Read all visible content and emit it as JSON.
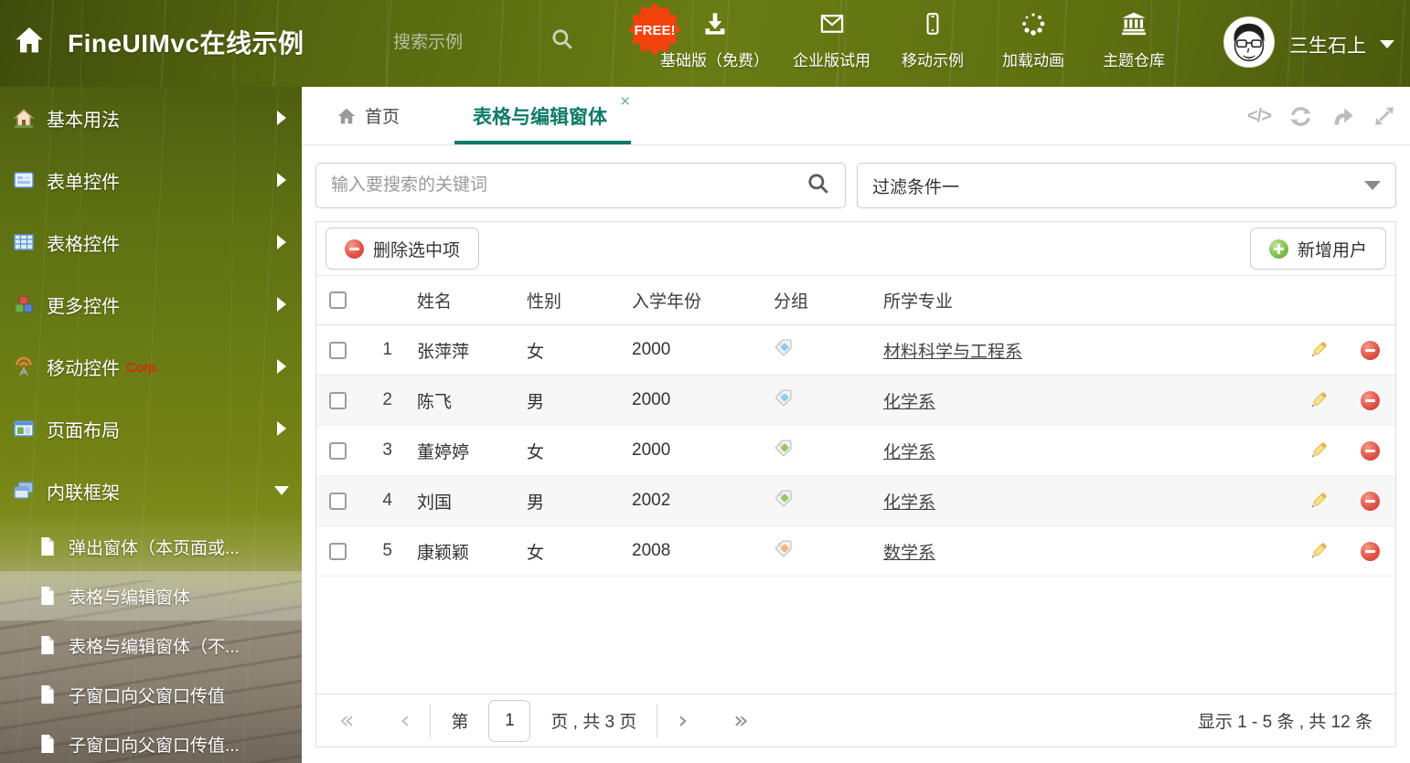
{
  "header": {
    "title": "FineUIMvc在线示例",
    "search_placeholder": "搜索示例",
    "free_badge": "FREE!",
    "nav_items": [
      {
        "label": "基础版（免费）",
        "icon": "download-icon"
      },
      {
        "label": "企业版试用",
        "icon": "mail-icon"
      },
      {
        "label": "移动示例",
        "icon": "mobile-icon"
      },
      {
        "label": "加载动画",
        "icon": "spinner-icon"
      },
      {
        "label": "主题仓库",
        "icon": "bank-icon"
      }
    ],
    "username": "三生石上"
  },
  "sidebar": {
    "items": [
      {
        "label": "基本用法",
        "icon": "house-icon"
      },
      {
        "label": "表单控件",
        "icon": "form-icon"
      },
      {
        "label": "表格控件",
        "icon": "table-icon"
      },
      {
        "label": "更多控件",
        "icon": "cubes-icon"
      },
      {
        "label": "移动控件",
        "badge": "Corp.",
        "icon": "antenna-icon"
      },
      {
        "label": "页面布局",
        "icon": "layout-icon"
      },
      {
        "label": "内联框架",
        "icon": "frames-icon"
      }
    ],
    "subitems": [
      {
        "label": "弹出窗体（本页面或..."
      },
      {
        "label": "表格与编辑窗体"
      },
      {
        "label": "表格与编辑窗体（不..."
      },
      {
        "label": "子窗口向父窗口传值"
      },
      {
        "label": "子窗口向父窗口传值..."
      }
    ]
  },
  "tabs": {
    "home": "首页",
    "active": "表格与编辑窗体"
  },
  "filters": {
    "keyword_placeholder": "输入要搜索的关键词",
    "filter_value": "过滤条件一"
  },
  "toolbar": {
    "delete_label": "删除选中项",
    "add_label": "新增用户"
  },
  "table": {
    "columns": {
      "name": "姓名",
      "gender": "性别",
      "year": "入学年份",
      "group": "分组",
      "major": "所学专业"
    },
    "rows": [
      {
        "num": "1",
        "name": "张萍萍",
        "gender": "女",
        "year": "2000",
        "tag": "blue",
        "major": "材料科学与工程系"
      },
      {
        "num": "2",
        "name": "陈飞",
        "gender": "男",
        "year": "2000",
        "tag": "blue",
        "major": "化学系"
      },
      {
        "num": "3",
        "name": "董婷婷",
        "gender": "女",
        "year": "2000",
        "tag": "green",
        "major": "化学系"
      },
      {
        "num": "4",
        "name": "刘国",
        "gender": "男",
        "year": "2002",
        "tag": "green",
        "major": "化学系"
      },
      {
        "num": "5",
        "name": "康颖颖",
        "gender": "女",
        "year": "2008",
        "tag": "orange",
        "major": "数学系"
      }
    ]
  },
  "pagination": {
    "page_prefix": "第",
    "current_page": "1",
    "page_suffix": "页 , 共 3 页",
    "summary": "显示 1 - 5 条 , 共 12 条"
  },
  "glyphs": {
    "close": "✕",
    "code": "</>",
    "first": "«",
    "prev": "‹",
    "next": "›",
    "last": "»"
  },
  "colors": {
    "accent": "#0e7b68",
    "header_green": "#697b13",
    "badge_red": "#f4420c",
    "corp_red": "#f50f0f",
    "tag_blue": "#8ecdf5",
    "tag_green": "#94c868",
    "tag_orange": "#f9b273"
  }
}
